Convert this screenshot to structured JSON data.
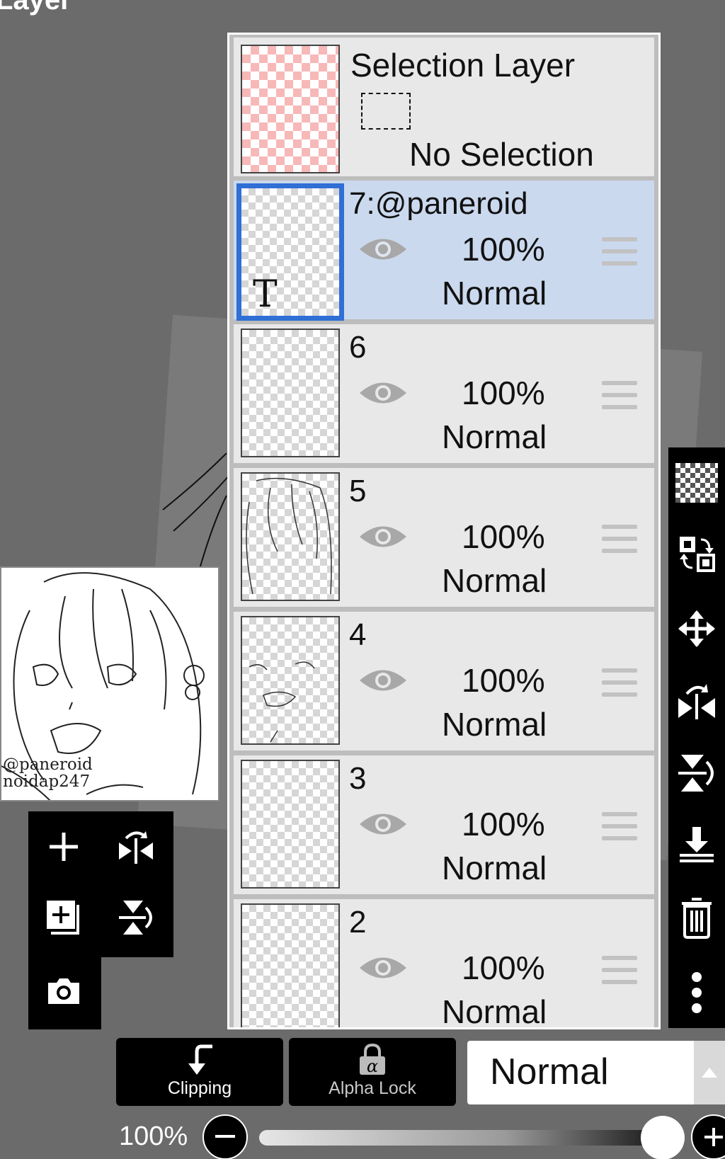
{
  "header": {
    "title": "Layer"
  },
  "preview": {
    "watermark_line1": "@paneroid",
    "watermark_line2": "noidap247"
  },
  "selection_layer": {
    "title": "Selection Layer",
    "status": "No Selection"
  },
  "layers": [
    {
      "name": "7:@paneroid",
      "opacity": "100%",
      "blend": "Normal",
      "active": true,
      "type_mark": "T"
    },
    {
      "name": "6",
      "opacity": "100%",
      "blend": "Normal",
      "active": false
    },
    {
      "name": "5",
      "opacity": "100%",
      "blend": "Normal",
      "active": false
    },
    {
      "name": "4",
      "opacity": "100%",
      "blend": "Normal",
      "active": false
    },
    {
      "name": "3",
      "opacity": "100%",
      "blend": "Normal",
      "active": false
    },
    {
      "name": "2",
      "opacity": "100%",
      "blend": "Normal",
      "active": false
    }
  ],
  "bottom": {
    "clipping_label": "Clipping",
    "alpha_lock_label": "Alpha Lock",
    "blend_mode": "Normal",
    "opacity_label": "100%",
    "opacity_value": 1.0
  },
  "icons": {
    "left_tools": [
      "plus-icon",
      "flip-horizontal-icon",
      "add-layer-icon",
      "flip-vertical-icon",
      "camera-icon"
    ],
    "right_tools": [
      "transparency-icon",
      "swap-layer-icon",
      "move-icon",
      "flip-horizontal-icon",
      "flip-vertical-icon",
      "merge-down-icon",
      "trash-icon",
      "more-icon"
    ]
  },
  "colors": {
    "active_row": "#cbd9ee",
    "active_border": "#2f6fd6",
    "background": "#6b6b6b"
  }
}
